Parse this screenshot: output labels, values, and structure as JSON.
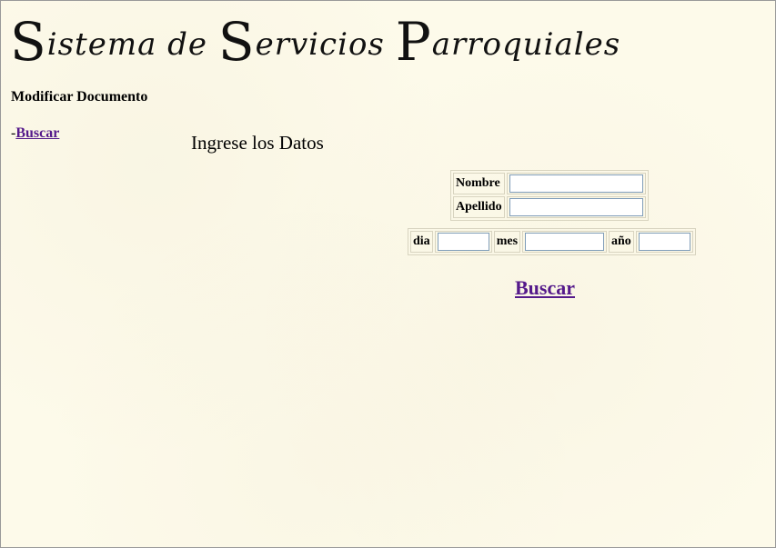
{
  "header": {
    "title_parts": [
      {
        "cap": "S",
        "rest": "istema de "
      },
      {
        "cap": "S",
        "rest": "ervicios "
      },
      {
        "cap": "P",
        "rest": "arroquiales"
      }
    ]
  },
  "section": {
    "title": "Modificar Documento"
  },
  "nav": {
    "prefix": "-",
    "search_link": "Buscar"
  },
  "form": {
    "heading": "Ingrese los Datos",
    "name_label": "Nombre",
    "name_value": "",
    "surname_label": "Apellido",
    "surname_value": "",
    "day_label": "dia",
    "day_value": "",
    "month_label": "mes",
    "month_value": "",
    "year_label": "año",
    "year_value": "",
    "submit_link": "Buscar"
  }
}
